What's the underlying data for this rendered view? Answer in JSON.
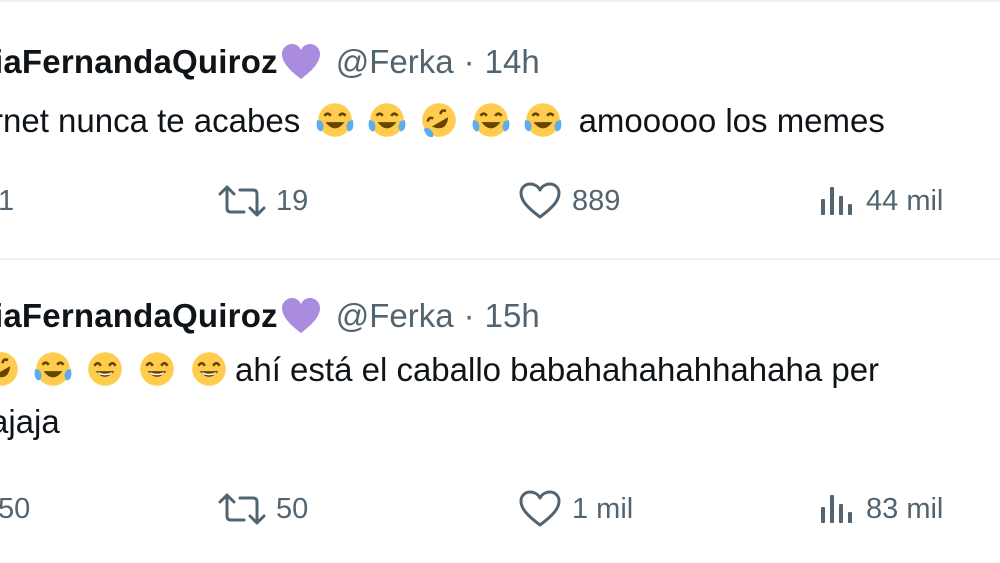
{
  "tweets": [
    {
      "display_name": "iaFernandaQuiroz",
      "handle": "@Ferka",
      "separator": "·",
      "time": "14h",
      "text_before": "rnet nunca te acabes",
      "emojis": [
        "face-with-tears-of-joy",
        "face-with-tears-of-joy",
        "rolling-on-floor-laughing",
        "face-with-tears-of-joy",
        "face-with-tears-of-joy"
      ],
      "text_after": "amooooo los memes",
      "actions": {
        "reply_count": "1",
        "retweet_count": "19",
        "like_count": "889",
        "views_count": "44 mil"
      }
    },
    {
      "display_name": "iaFernandaQuiroz",
      "handle": "@Ferka",
      "separator": "·",
      "time": "15h",
      "emojis": [
        "rolling-on-floor-laughing",
        "face-with-tears-of-joy",
        "grinning-squinting-face",
        "grinning-squinting-face",
        "grinning-squinting-face"
      ],
      "text_after": "ahí está el caballo babahahahahhahaha per",
      "text_line_2": "ajaja",
      "actions": {
        "reply_count": "50",
        "retweet_count": "50",
        "like_count": "1 mil",
        "views_count": "83 mil"
      }
    }
  ],
  "icons": {
    "heart_emoji": "purple-heart-icon",
    "reply": "reply-icon",
    "retweet": "retweet-icon",
    "like": "like-icon",
    "views": "views-icon"
  },
  "colors": {
    "text": "#0f1419",
    "secondary": "#536471",
    "divider": "#eff3f4",
    "heart": "#a98be0",
    "emoji_face": "#ffcc4d",
    "tears": "#5dadec"
  }
}
